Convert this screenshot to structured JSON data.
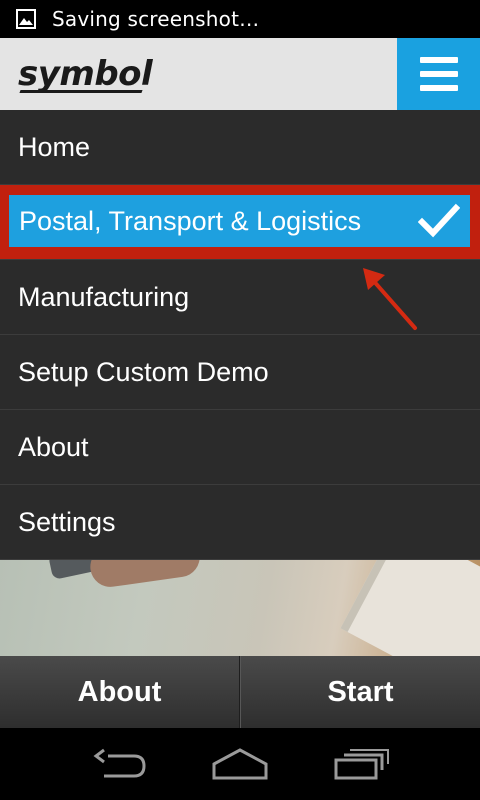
{
  "status_bar": {
    "notification_icon": "image-icon",
    "text": "Saving screenshot…"
  },
  "header": {
    "logo_text": "symbol",
    "menu_icon": "hamburger-menu-icon",
    "accent_color": "#1aa1e0"
  },
  "menu": {
    "items": [
      {
        "label": "Home",
        "selected": false
      },
      {
        "label": "Postal, Transport & Logistics",
        "selected": true
      },
      {
        "label": "Manufacturing",
        "selected": false
      },
      {
        "label": "Setup Custom Demo",
        "selected": false
      },
      {
        "label": "About",
        "selected": false
      },
      {
        "label": "Settings",
        "selected": false
      }
    ],
    "selected_icon": "checkmark-icon",
    "highlight_color": "#1ea0df",
    "annotation_color": "#c1200e"
  },
  "action_bar": {
    "about_label": "About",
    "start_label": "Start"
  },
  "nav_bar": {
    "back_icon": "back-icon",
    "home_icon": "home-icon",
    "recents_icon": "recent-apps-icon"
  }
}
